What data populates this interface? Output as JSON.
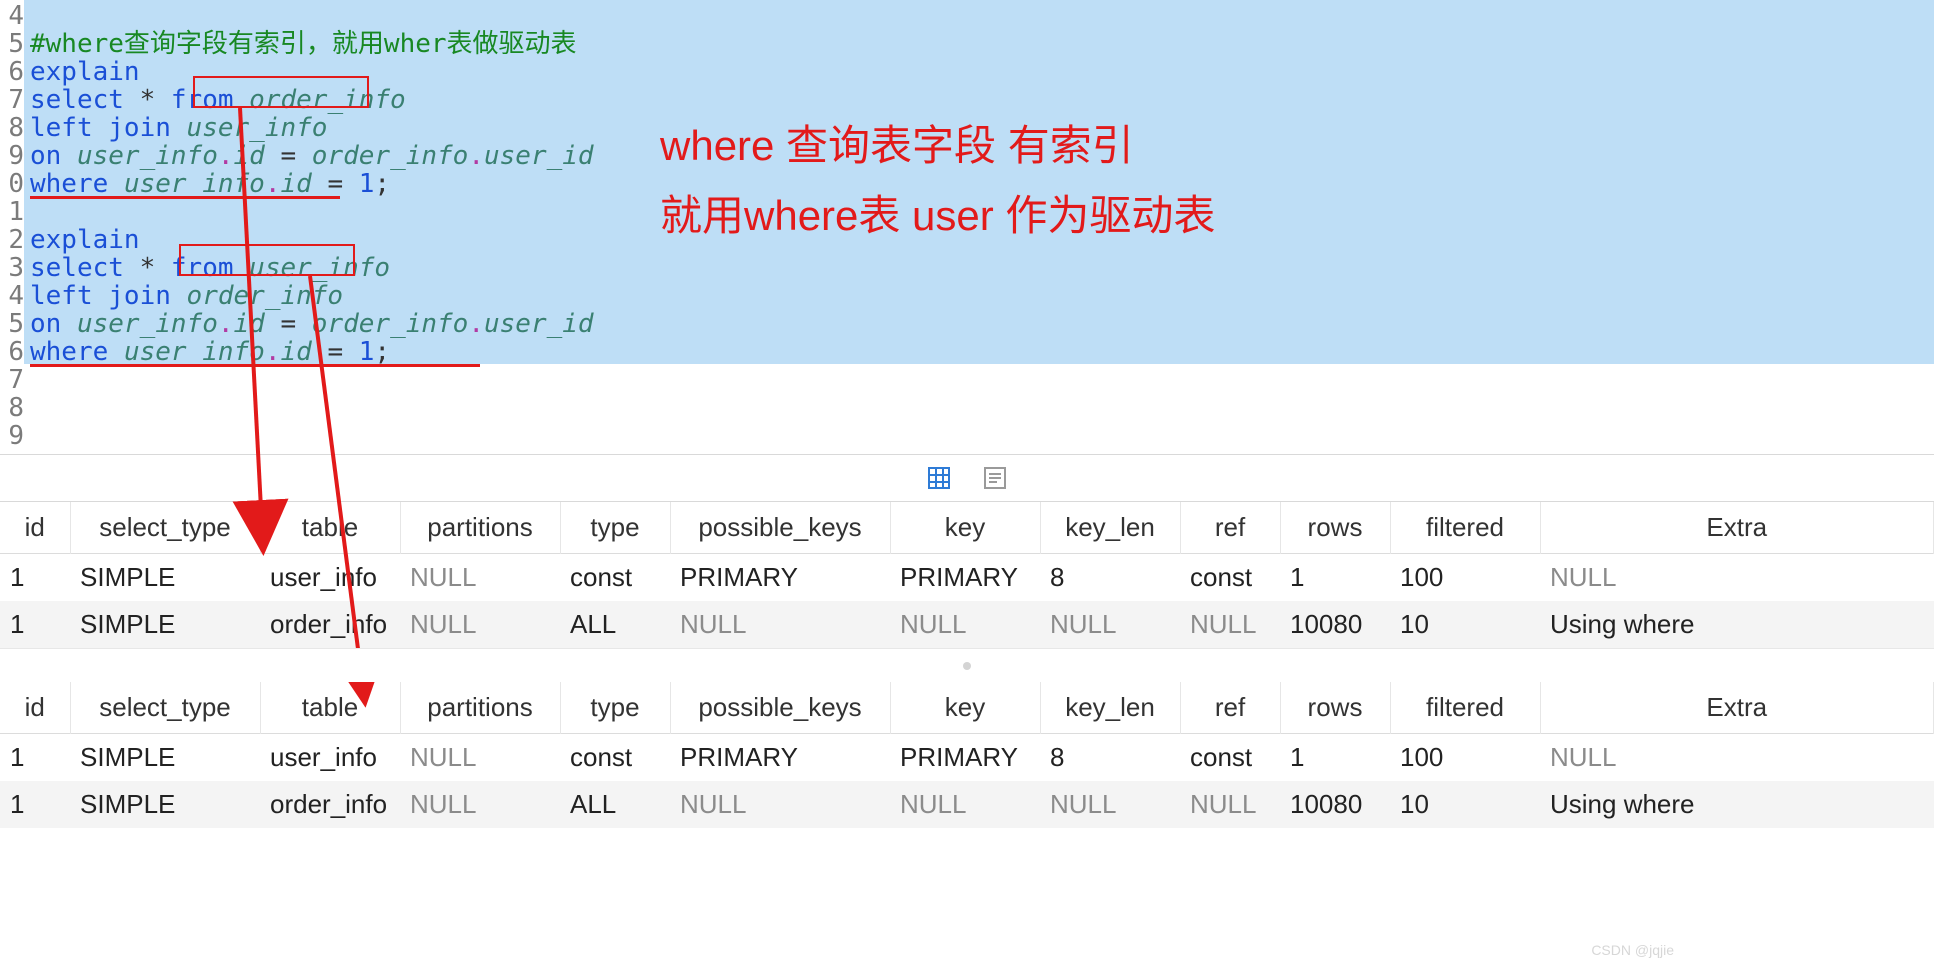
{
  "gutter": [
    "4",
    "5",
    "6",
    "7",
    "8",
    "9",
    "0",
    "1",
    "2",
    "3",
    "4",
    "5",
    "6",
    "7",
    "8",
    "9"
  ],
  "code": {
    "l5_comment": "#where查询字段有索引，就用wher表做驱动表",
    "l6_kw": "explain",
    "l7_kw1": "select",
    "l7_star": "*",
    "l7_kw2": "from",
    "l7_tbl": "order_info",
    "l8_kw": "left join",
    "l8_tbl": "user_info",
    "l9_kw": "on",
    "l9_t1": "user_info",
    "l9_dot1": ".",
    "l9_c1": "id",
    "l9_eq1": " = ",
    "l9_t2": "order_info",
    "l9_dot2": ".",
    "l9_c2": "user_id",
    "l10_kw": "where",
    "l10_t": "user_info",
    "l10_dot": ".",
    "l10_c": "id",
    "l10_eq": " = ",
    "l10_n": "1",
    "l10_semi": ";",
    "l12_kw": "explain",
    "l13_kw1": "select",
    "l13_star": "*",
    "l13_kw2": "from",
    "l13_tbl": "user_info",
    "l14_kw": "left join",
    "l14_tbl": "order_info",
    "l15_kw": "on",
    "l15_t1": "user_info",
    "l15_dot1": ".",
    "l15_c1": "id",
    "l15_eq1": " = ",
    "l15_t2": "order_info",
    "l15_dot2": ".",
    "l15_c2": "user_id",
    "l16_kw": "where",
    "l16_t": "user_info",
    "l16_dot": ".",
    "l16_c": "id",
    "l16_eq": " = ",
    "l16_n": "1",
    "l16_semi": ";"
  },
  "annotation": {
    "line1": "where 查询表字段 有索引",
    "line2": "就用where表 user 作为驱动表"
  },
  "headers": [
    "id",
    "select_type",
    "table",
    "partitions",
    "type",
    "possible_keys",
    "key",
    "key_len",
    "ref",
    "rows",
    "filtered",
    "Extra"
  ],
  "table1": [
    {
      "id": "1",
      "select_type": "SIMPLE",
      "table": "user_info",
      "partitions": "NULL",
      "type": "const",
      "possible_keys": "PRIMARY",
      "key": "PRIMARY",
      "key_len": "8",
      "ref": "const",
      "rows": "1",
      "filtered": "100",
      "Extra": "NULL"
    },
    {
      "id": "1",
      "select_type": "SIMPLE",
      "table": "order_info",
      "partitions": "NULL",
      "type": "ALL",
      "possible_keys": "NULL",
      "key": "NULL",
      "key_len": "NULL",
      "ref": "NULL",
      "rows": "10080",
      "filtered": "10",
      "Extra": "Using where"
    }
  ],
  "table2": [
    {
      "id": "1",
      "select_type": "SIMPLE",
      "table": "user_info",
      "partitions": "NULL",
      "type": "const",
      "possible_keys": "PRIMARY",
      "key": "PRIMARY",
      "key_len": "8",
      "ref": "const",
      "rows": "1",
      "filtered": "100",
      "Extra": "NULL"
    },
    {
      "id": "1",
      "select_type": "SIMPLE",
      "table": "order_info",
      "partitions": "NULL",
      "type": "ALL",
      "possible_keys": "NULL",
      "key": "NULL",
      "key_len": "NULL",
      "ref": "NULL",
      "rows": "10080",
      "filtered": "10",
      "Extra": "Using where"
    }
  ],
  "watermark": "CSDN @jqjie"
}
